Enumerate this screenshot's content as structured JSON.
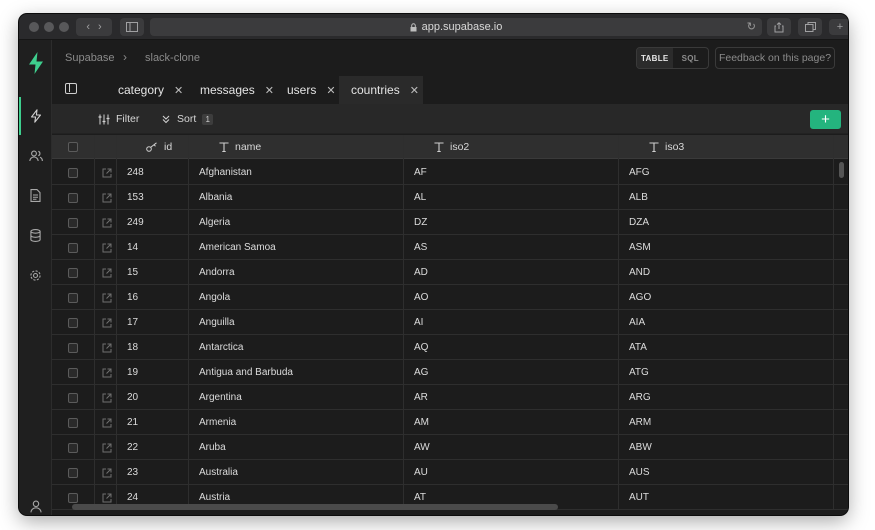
{
  "browser": {
    "url": "app.supabase.io"
  },
  "breadcrumb": {
    "org": "Supabase",
    "project": "slack-clone"
  },
  "header": {
    "table_label": "TABLE",
    "sql_label": "SQL",
    "feedback_label": "Feedback on this page?"
  },
  "tabs": [
    {
      "label": "category",
      "active": false
    },
    {
      "label": "messages",
      "active": false
    },
    {
      "label": "users",
      "active": false
    },
    {
      "label": "countries",
      "active": true
    }
  ],
  "toolbar": {
    "filter_label": "Filter",
    "sort_label": "Sort",
    "sort_count": "1",
    "add_label": "+"
  },
  "columns": [
    {
      "key": "id",
      "label": "id",
      "icon": "key-icon"
    },
    {
      "key": "name",
      "label": "name",
      "icon": "text-type-icon"
    },
    {
      "key": "iso2",
      "label": "iso2",
      "icon": "text-type-icon"
    },
    {
      "key": "iso3",
      "label": "iso3",
      "icon": "text-type-icon"
    }
  ],
  "rows": [
    {
      "id": "248",
      "name": "Afghanistan",
      "iso2": "AF",
      "iso3": "AFG"
    },
    {
      "id": "153",
      "name": "Albania",
      "iso2": "AL",
      "iso3": "ALB"
    },
    {
      "id": "249",
      "name": "Algeria",
      "iso2": "DZ",
      "iso3": "DZA"
    },
    {
      "id": "14",
      "name": "American Samoa",
      "iso2": "AS",
      "iso3": "ASM"
    },
    {
      "id": "15",
      "name": "Andorra",
      "iso2": "AD",
      "iso3": "AND"
    },
    {
      "id": "16",
      "name": "Angola",
      "iso2": "AO",
      "iso3": "AGO"
    },
    {
      "id": "17",
      "name": "Anguilla",
      "iso2": "AI",
      "iso3": "AIA"
    },
    {
      "id": "18",
      "name": "Antarctica",
      "iso2": "AQ",
      "iso3": "ATA"
    },
    {
      "id": "19",
      "name": "Antigua and Barbuda",
      "iso2": "AG",
      "iso3": "ATG"
    },
    {
      "id": "20",
      "name": "Argentina",
      "iso2": "AR",
      "iso3": "ARG"
    },
    {
      "id": "21",
      "name": "Armenia",
      "iso2": "AM",
      "iso3": "ARM"
    },
    {
      "id": "22",
      "name": "Aruba",
      "iso2": "AW",
      "iso3": "ABW"
    },
    {
      "id": "23",
      "name": "Australia",
      "iso2": "AU",
      "iso3": "AUS"
    },
    {
      "id": "24",
      "name": "Austria",
      "iso2": "AT",
      "iso3": "AUT"
    }
  ],
  "rail": [
    "bolt-icon",
    "users-icon",
    "document-icon",
    "database-icon",
    "settings-icon",
    "account-icon"
  ],
  "colors": {
    "accent": "#3ecf8e",
    "add_button": "#24b47e",
    "background": "#1c1c1c",
    "header": "#2f2f2f"
  }
}
